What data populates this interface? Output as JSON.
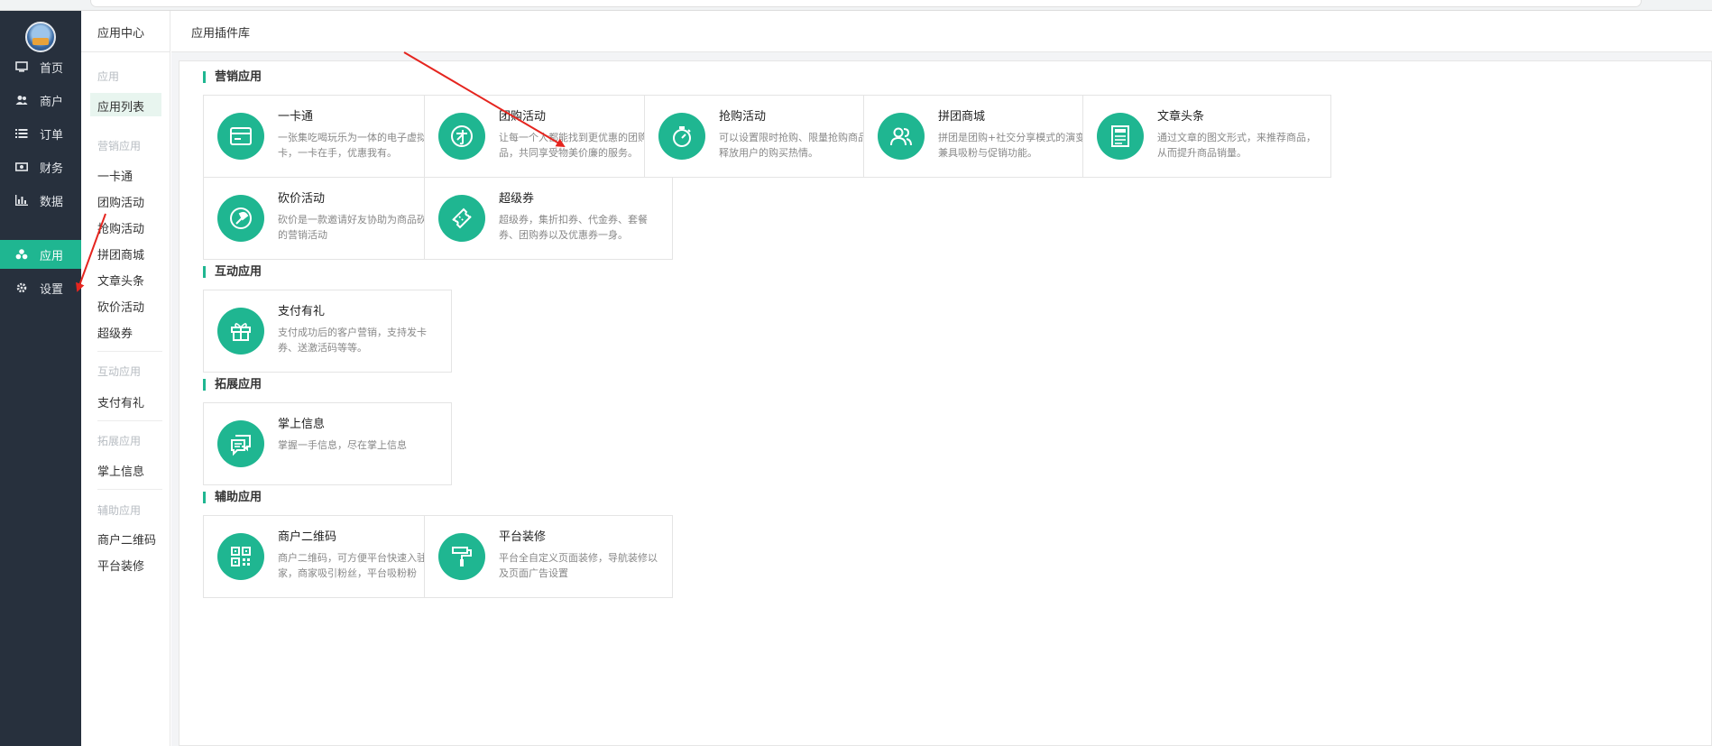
{
  "colors": {
    "accent": "#1fb691",
    "sidebar_bg": "#27303d",
    "arrow": "#e5251f"
  },
  "sidebar": {
    "items": [
      {
        "label": "首页",
        "icon": "monitor-icon"
      },
      {
        "label": "商户",
        "icon": "users-icon"
      },
      {
        "label": "订单",
        "icon": "list-icon"
      },
      {
        "label": "财务",
        "icon": "money-icon"
      },
      {
        "label": "数据",
        "icon": "bar-chart-icon"
      },
      {
        "label": "应用",
        "icon": "cubes-icon"
      },
      {
        "label": "设置",
        "icon": "gear-icon"
      }
    ],
    "active": "应用"
  },
  "subnav": {
    "header": "应用中心",
    "group_app": "应用",
    "app_list": "应用列表",
    "group_marketing": "营销应用",
    "marketing_items": [
      "一卡通",
      "团购活动",
      "抢购活动",
      "拼团商城",
      "文章头条",
      "砍价活动",
      "超级券"
    ],
    "group_interactive": "互动应用",
    "interactive_items": [
      "支付有礼"
    ],
    "group_extend": "拓展应用",
    "extend_items": [
      "掌上信息"
    ],
    "group_assist": "辅助应用",
    "assist_items": [
      "商户二维码",
      "平台装修"
    ]
  },
  "header": {
    "title": "应用插件库"
  },
  "sections": [
    {
      "title": "营销应用",
      "cards": [
        {
          "name": "一卡通",
          "desc": "一张集吃喝玩乐为一体的电子虚拟卡，一卡在手，优惠我有。",
          "icon": "card-icon"
        },
        {
          "name": "团购活动",
          "desc": "让每一个人都能找到更优惠的团购商品，共同享受物美价廉的服务。",
          "icon": "group-buy-icon"
        },
        {
          "name": "抢购活动",
          "desc": "可以设置限时抢购、限量抢购商品，释放用户的购买热情。",
          "icon": "stopwatch-icon"
        },
        {
          "name": "拼团商城",
          "desc": "拼团是团购+社交分享模式的演变，兼具吸粉与促销功能。",
          "icon": "people-icon"
        },
        {
          "name": "文章头条",
          "desc": "通过文章的图文形式，来推荐商品，从而提升商品销量。",
          "icon": "news-icon"
        },
        {
          "name": "砍价活动",
          "desc": "砍价是一款邀请好友协助为商品砍价的营销活动",
          "icon": "axe-icon"
        },
        {
          "name": "超级券",
          "desc": "超级券，集折扣券、代金券、套餐券、团购券以及优惠券一身。",
          "icon": "ticket-icon"
        }
      ]
    },
    {
      "title": "互动应用",
      "cards": [
        {
          "name": "支付有礼",
          "desc": "支付成功后的客户营销，支持发卡券、送激活码等等。",
          "icon": "gift-icon"
        }
      ]
    },
    {
      "title": "拓展应用",
      "cards": [
        {
          "name": "掌上信息",
          "desc": "掌握一手信息，尽在掌上信息",
          "icon": "chat-icon"
        }
      ]
    },
    {
      "title": "辅助应用",
      "cards": [
        {
          "name": "商户二维码",
          "desc": "商户二维码，可方便平台快速入驻商家，商家吸引粉丝，平台吸粉粉",
          "icon": "qrcode-icon"
        },
        {
          "name": "平台装修",
          "desc": "平台全自定义页面装修，导航装修以及页面广告设置",
          "icon": "paint-roller-icon"
        }
      ]
    }
  ]
}
